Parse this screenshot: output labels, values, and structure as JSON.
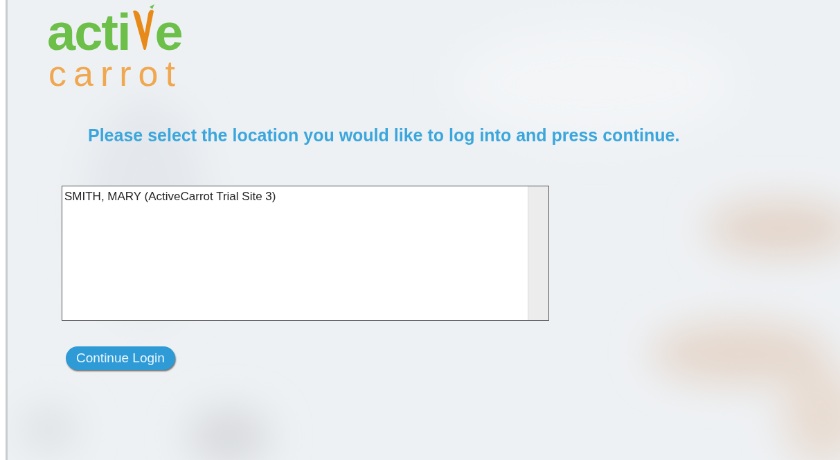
{
  "logo": {
    "word_start": "acti",
    "word_end": "e",
    "tagline": "carrot"
  },
  "heading": "Please select the location you would like to log into and press continue.",
  "locations": [
    {
      "label": "SMITH, MARY (ActiveCarrot Trial Site 3)",
      "selected": false
    }
  ],
  "button": "Continue Login"
}
